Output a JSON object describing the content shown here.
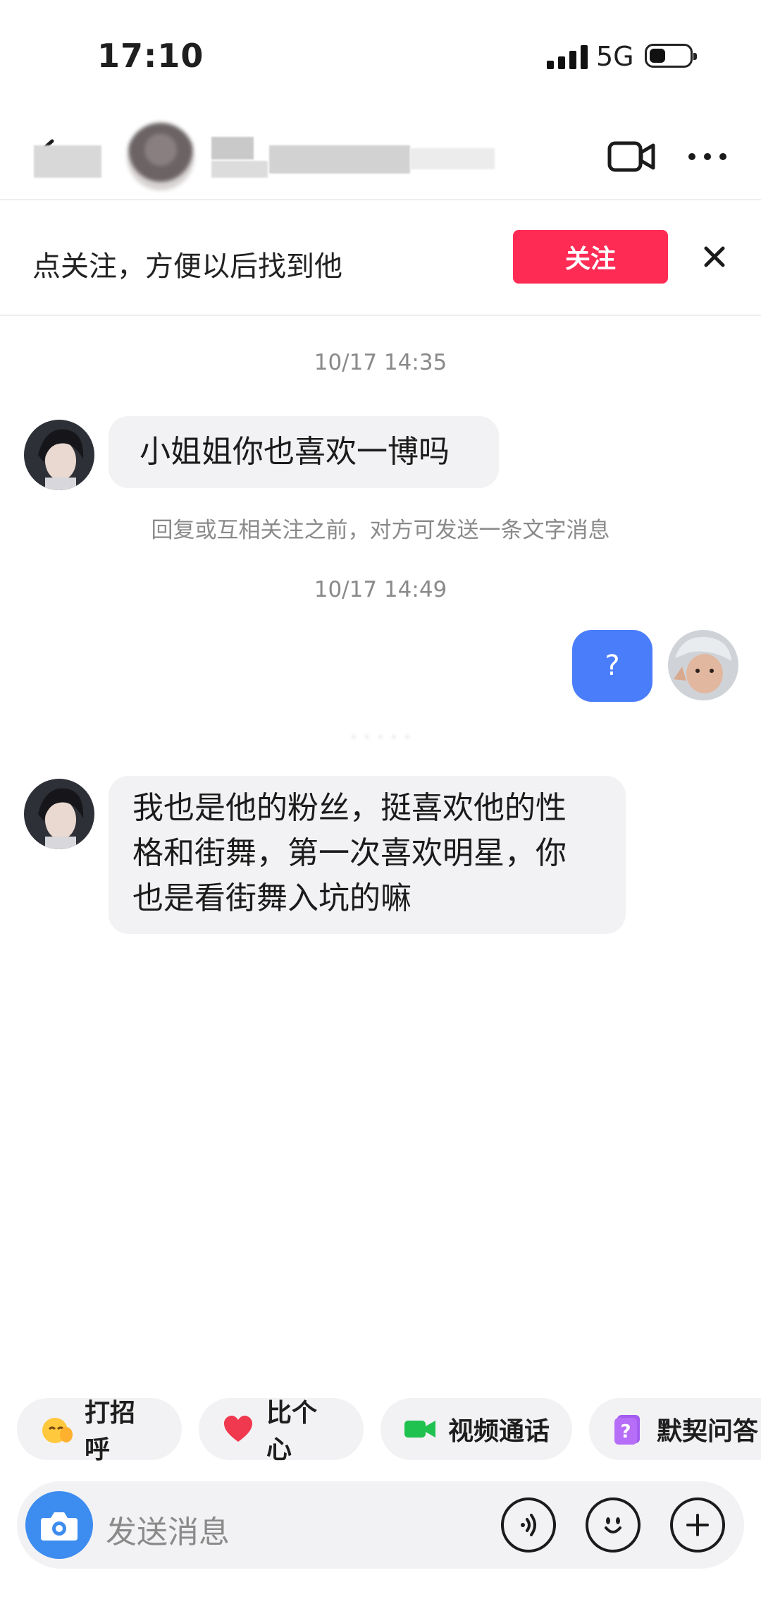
{
  "status_bar": {
    "time": "17:10",
    "network": "5G"
  },
  "header": {
    "contact_name_redacted": ""
  },
  "follow_banner": {
    "text": "点关注，方便以后找到他",
    "button": "关注"
  },
  "messages": [
    {
      "timestamp": "10/17 14:35"
    },
    {
      "from": "other",
      "text": "小姐姐你也喜欢一博吗"
    },
    {
      "notice": "回复或互相关注之前，对方可发送一条文字消息"
    },
    {
      "timestamp": "10/17 14:49"
    },
    {
      "from": "me",
      "text": "?"
    },
    {
      "from": "other",
      "text": "我也是他的粉丝，挺喜欢他的性格和街舞，第一次喜欢明星，你也是看街舞入坑的嘛",
      "lines": [
        "我也是他的粉丝，挺喜欢他的性",
        "格和街舞，第一次喜欢明星，你",
        "也是看街舞入坑的嘛"
      ]
    }
  ],
  "quick_actions": [
    {
      "label": "打招呼",
      "icon": "wave-emoji-icon"
    },
    {
      "label": "比个心",
      "icon": "heart-icon"
    },
    {
      "label": "视频通话",
      "icon": "video-call-icon"
    },
    {
      "label": "默契问答",
      "icon": "question-card-icon"
    }
  ],
  "input": {
    "placeholder": "发送消息"
  },
  "colors": {
    "accent_follow": "#fe2c55",
    "my_bubble": "#4a7dfa",
    "bubble_other": "#f2f2f4",
    "camera": "#3d8cf0"
  }
}
